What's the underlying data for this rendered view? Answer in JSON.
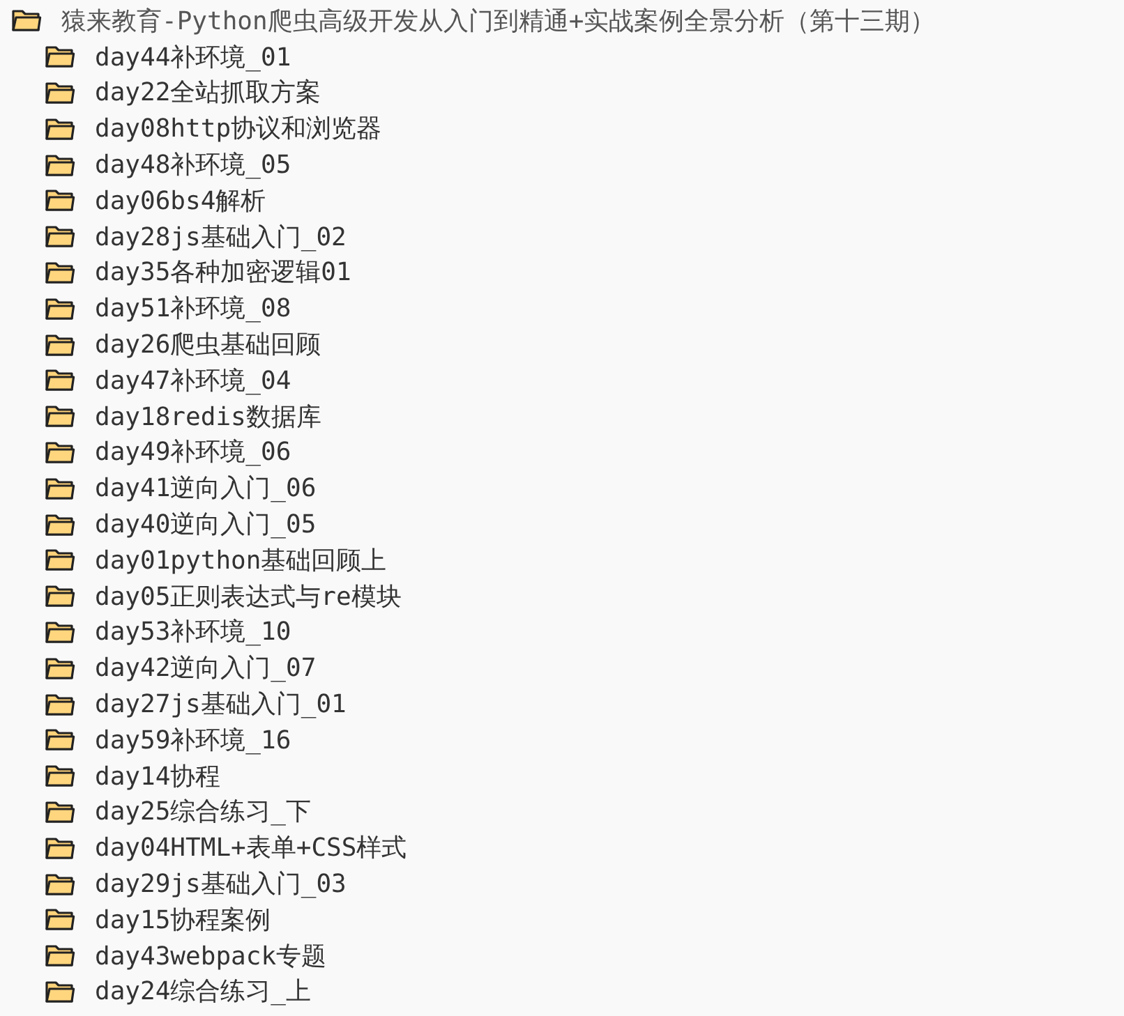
{
  "tree": {
    "label": "猿来教育-Python爬虫高级开发从入门到精通+实战案例全景分析（第十三期）",
    "children": [
      {
        "label": "day44补环境_01"
      },
      {
        "label": "day22全站抓取方案"
      },
      {
        "label": "day08http协议和浏览器"
      },
      {
        "label": "day48补环境_05"
      },
      {
        "label": "day06bs4解析"
      },
      {
        "label": "day28js基础入门_02"
      },
      {
        "label": "day35各种加密逻辑01"
      },
      {
        "label": "day51补环境_08"
      },
      {
        "label": "day26爬虫基础回顾"
      },
      {
        "label": "day47补环境_04"
      },
      {
        "label": "day18redis数据库"
      },
      {
        "label": "day49补环境_06"
      },
      {
        "label": "day41逆向入门_06"
      },
      {
        "label": "day40逆向入门_05"
      },
      {
        "label": "day01python基础回顾上"
      },
      {
        "label": "day05正则表达式与re模块"
      },
      {
        "label": "day53补环境_10"
      },
      {
        "label": "day42逆向入门_07"
      },
      {
        "label": "day27js基础入门_01"
      },
      {
        "label": "day59补环境_16"
      },
      {
        "label": "day14协程"
      },
      {
        "label": "day25综合练习_下"
      },
      {
        "label": "day04HTML+表单+CSS样式"
      },
      {
        "label": "day29js基础入门_03"
      },
      {
        "label": "day15协程案例"
      },
      {
        "label": "day43webpack专题"
      },
      {
        "label": "day24综合练习_上"
      }
    ]
  }
}
